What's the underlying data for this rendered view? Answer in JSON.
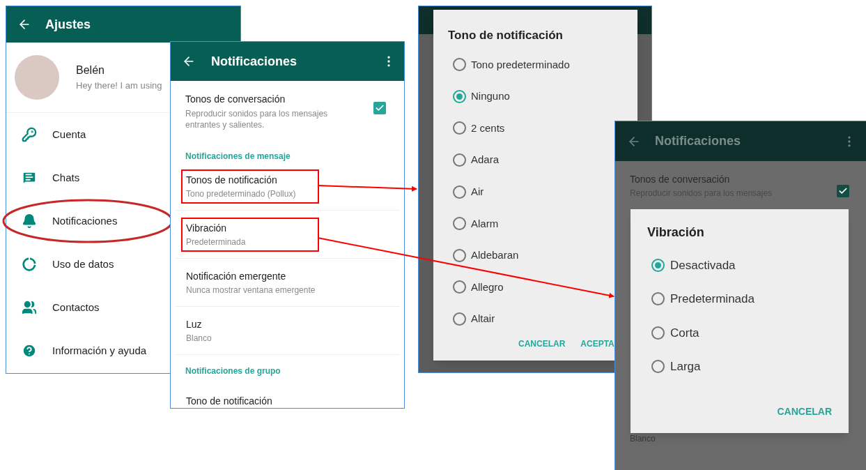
{
  "settings_screen": {
    "title": "Ajustes",
    "profile": {
      "name": "Belén",
      "status": "Hey there!  I am using"
    },
    "items": [
      {
        "label": "Cuenta",
        "circled": false
      },
      {
        "label": "Chats",
        "circled": false
      },
      {
        "label": "Notificaciones",
        "circled": true
      },
      {
        "label": "Uso de datos",
        "circled": false
      },
      {
        "label": "Contactos",
        "circled": false
      },
      {
        "label": "Información y ayuda",
        "circled": false
      }
    ]
  },
  "notifications_screen": {
    "title": "Notificaciones",
    "items": [
      {
        "kind": "checkbox",
        "title": "Tonos de conversación",
        "subtitle": "Reproducir sonidos para los mensajes entrantes y salientes.",
        "checked": true
      },
      {
        "kind": "header",
        "title": "Notificaciones de mensaje"
      },
      {
        "kind": "item",
        "title": "Tonos de notificación",
        "subtitle": "Tono predeterminado (Pollux)",
        "highlighted": true
      },
      {
        "kind": "item",
        "title": "Vibración",
        "subtitle": "Predeterminada",
        "highlighted": true
      },
      {
        "kind": "item",
        "title": "Notificación emergente",
        "subtitle": "Nunca mostrar ventana emergente",
        "highlighted": false
      },
      {
        "kind": "item",
        "title": "Luz",
        "subtitle": "Blanco",
        "highlighted": false
      },
      {
        "kind": "header",
        "title": "Notificaciones de grupo"
      },
      {
        "kind": "item",
        "title": "Tono de notificación",
        "highlighted": false
      }
    ]
  },
  "tone_dialog": {
    "title": "Tono de notificación",
    "options": [
      {
        "label": "Tono predeterminado",
        "selected": false
      },
      {
        "label": "Ninguno",
        "selected": true
      },
      {
        "label": "2 cents",
        "selected": false
      },
      {
        "label": "Adara",
        "selected": false
      },
      {
        "label": "Air",
        "selected": false
      },
      {
        "label": "Alarm",
        "selected": false
      },
      {
        "label": "Aldebaran",
        "selected": false
      },
      {
        "label": "Allegro",
        "selected": false
      },
      {
        "label": "Altair",
        "selected": false
      }
    ],
    "buttons": [
      "CANCELAR",
      "ACEPTA"
    ]
  },
  "vibration_screen": {
    "title": "Notificaciones",
    "background": {
      "title": "Tonos de conversación",
      "subtitle": "Reproducir sonidos para los mensajes",
      "checked": true,
      "footer": "Blanco"
    },
    "dialog": {
      "title": "Vibración",
      "options": [
        {
          "label": "Desactivada",
          "selected": true
        },
        {
          "label": "Predeterminada",
          "selected": false
        },
        {
          "label": "Corta",
          "selected": false
        },
        {
          "label": "Larga",
          "selected": false
        }
      ],
      "buttons": [
        "CANCELAR"
      ]
    }
  }
}
